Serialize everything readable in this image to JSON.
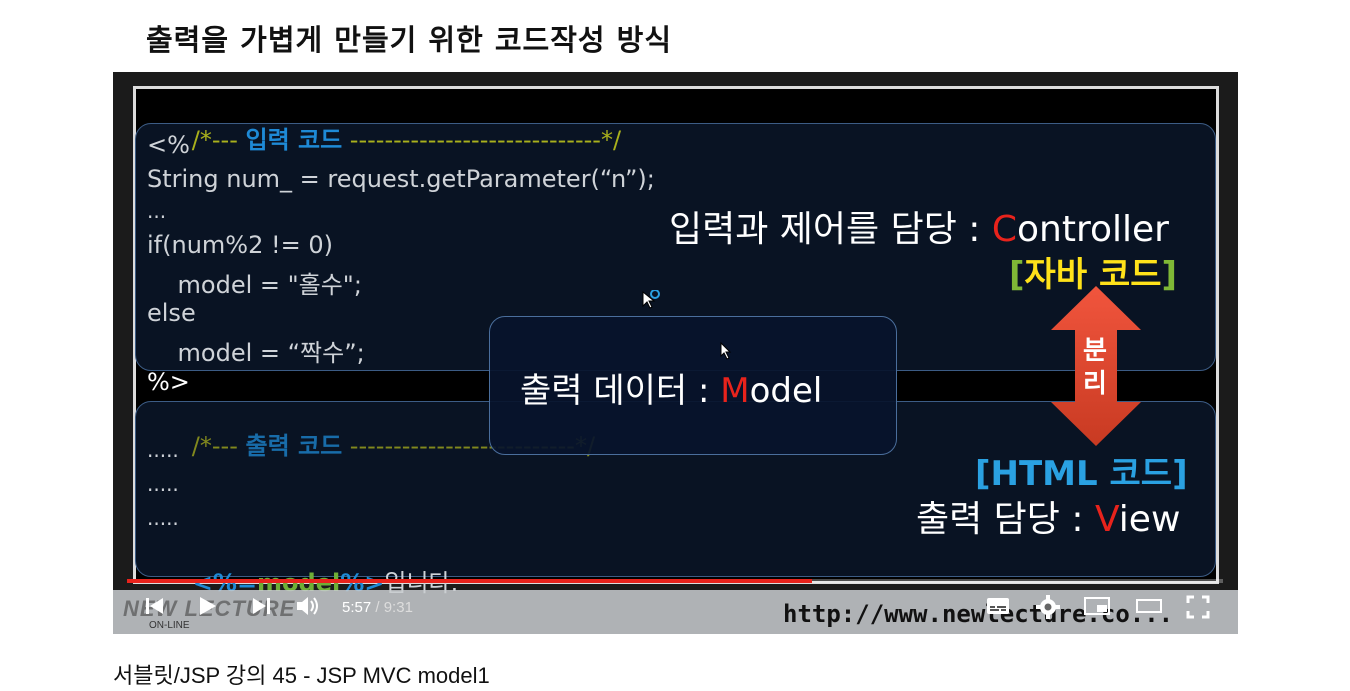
{
  "slide": {
    "title": "출력을 가볍게 만들기 위한 코드작성 방식",
    "input_comment_prefix": "/*--- ",
    "input_comment_label": "입력 코드",
    "input_comment_suffix": " -----------------------------*/",
    "code_lines": [
      "<%",
      "String num_ = request.getParameter(“n”);",
      "...",
      "if(num%2 != 0)",
      "    model = \"홀수\";",
      "else",
      "    model = “짝수”;",
      "%>"
    ],
    "output_comment_prefix": "/*--- ",
    "output_comment_label": "출력 코드",
    "output_comment_suffix": " --------------------------*/",
    "output_lines": [
      ".....",
      ".....",
      "....."
    ],
    "expr_open": "<%=",
    "expr_var": "model",
    "expr_close": "%>",
    "expr_suffix": "입니다.",
    "controller_label_prefix": "입력과 제어를 담당 : ",
    "controller_initial": "C",
    "controller_rest": "ontroller",
    "java_bracket_open": "[",
    "java_label": "자바 코드",
    "java_bracket_close": "]",
    "separate_label_1": "분",
    "separate_label_2": "리",
    "model_label_prefix": "출력 데이터 : ",
    "model_initial": "M",
    "model_rest": "odel",
    "html_label": "[HTML 코드]",
    "view_label_prefix": "출력 담당 : ",
    "view_initial": "V",
    "view_rest": "iew",
    "url": "http://www.newlecture.co..."
  },
  "player": {
    "current_time": "5:57",
    "separator": " / ",
    "total_time": "9:31",
    "progress_fraction": 0.625,
    "logo_text": "NEW LECTURE",
    "logo_subtext": "ON-LINE"
  },
  "video_title": "서블릿/JSP 강의 45 - JSP MVC model1",
  "colors": {
    "accent_red": "#e8231c",
    "comment_olive": "#a9b01c",
    "keyword_blue": "#1e8ad6",
    "java_yellow": "#ffe21a"
  }
}
